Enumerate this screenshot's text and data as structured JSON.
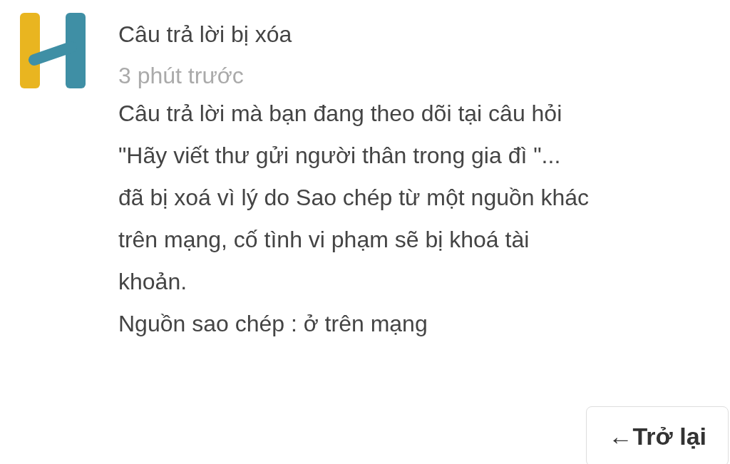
{
  "notification": {
    "title": "Câu trả lời bị xóa",
    "time": "3 phút trước",
    "body": "Câu trả lời mà bạn đang theo dõi tại câu hỏi\n\"Hãy viết thư gửi người thân trong gia đì \"...\nđã bị xoá vì lý do Sao chép từ một nguồn khác\ntrên mạng, cố tình vi phạm sẽ bị khoá tài\nkhoản.",
    "source": "Nguồn sao chép : ở trên mạng"
  },
  "back_button": {
    "arrow": "←",
    "label": "Trở lại"
  }
}
